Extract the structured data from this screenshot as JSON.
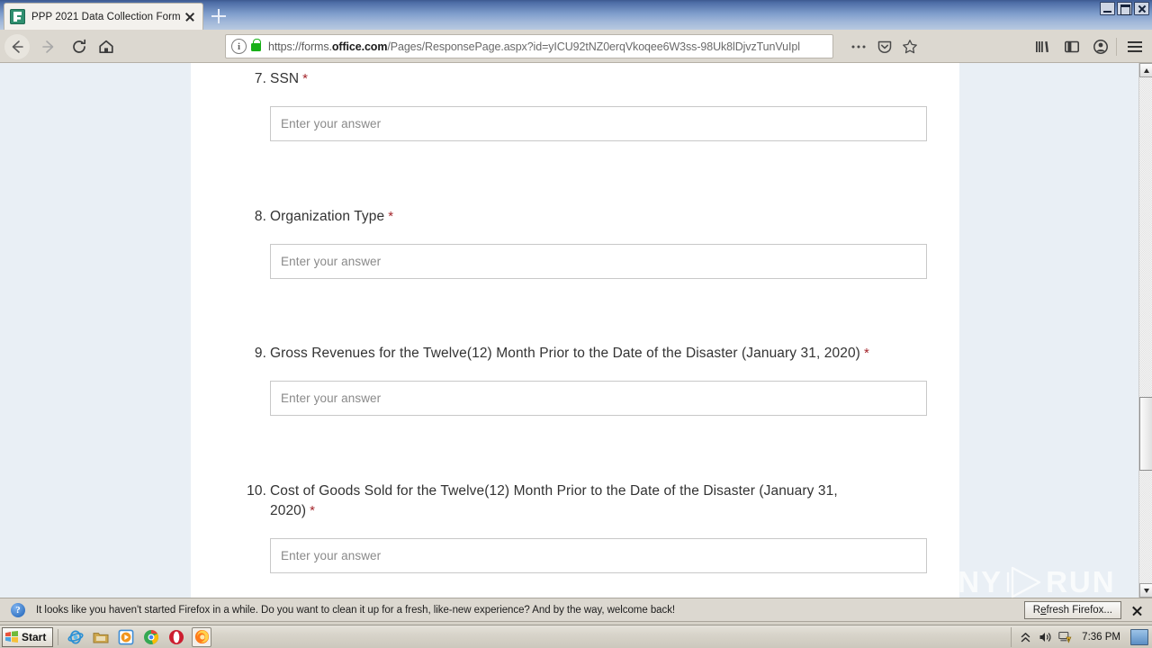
{
  "browser": {
    "tab": {
      "title": "PPP 2021 Data Collection Form",
      "favicon": "microsoft-forms-icon",
      "close_label": "×"
    },
    "newtab_label": "+",
    "window_controls": {
      "minimize": "minimize-icon",
      "restore": "restore-icon",
      "close": "close-icon"
    },
    "nav": {
      "back": "back-arrow-icon",
      "forward": "forward-arrow-icon",
      "reload": "reload-icon",
      "home": "home-icon"
    },
    "urlbar": {
      "identity_icon": "i",
      "lock_icon": "lock-icon",
      "url_prefix": "https://forms.",
      "url_domain": "office.com",
      "url_suffix": "/Pages/ResponsePage.aspx?id=yICU92tNZ0erqVkoqee6W3ss-98Uk8lDjvzTunVuIpl",
      "page_actions": "ellipsis-icon",
      "pocket": "pocket-icon",
      "bookmark": "star-icon"
    },
    "toolbar": {
      "library": "library-icon",
      "sidebar": "sidebar-icon",
      "account": "account-icon",
      "menu": "hamburger-menu-icon"
    }
  },
  "form": {
    "placeholder": "Enter your answer",
    "required_marker": "*",
    "questions": [
      {
        "number": "7.",
        "text": "SSN",
        "required": true,
        "lines": [
          "SSN"
        ]
      },
      {
        "number": "8.",
        "text": "Organization Type",
        "required": true,
        "lines": [
          "Organization Type"
        ]
      },
      {
        "number": "9.",
        "text": "Gross Revenues for the Twelve(12) Month Prior to the Date of the Disaster (January 31, 2020)",
        "required": true,
        "lines": [
          "Gross Revenues for the Twelve(12) Month Prior to the Date of the Disaster (January 31, 2020)"
        ]
      },
      {
        "number": "10.",
        "text": "Cost of Goods Sold for the Twelve(12) Month Prior to the Date of the Disaster (January 31, 2020)",
        "required": true,
        "lines": [
          "Cost of Goods Sold for the Twelve(12) Month Prior to the Date of the Disaster (January 31,",
          "2020)"
        ]
      }
    ]
  },
  "notification": {
    "icon": "info-icon",
    "message": "It looks like you haven't started Firefox in a while. Do you want to clean it up for a fresh, like-new experience? And by the way, welcome back!",
    "button_prefix": "R",
    "button_accel": "e",
    "button_suffix": "fresh Firefox...",
    "close": "close-icon"
  },
  "watermark": {
    "left": "ANY",
    "right": "RUN",
    "logo": "play-button-logo"
  },
  "taskbar": {
    "start_label": "Start",
    "quicklaunch": [
      {
        "name": "internet-explorer-icon"
      },
      {
        "name": "folder-icon"
      },
      {
        "name": "media-player-icon"
      },
      {
        "name": "chrome-icon"
      },
      {
        "name": "opera-icon"
      },
      {
        "name": "firefox-icon",
        "active": true
      }
    ],
    "tray": {
      "chevron": "show-hidden-icons-icon",
      "volume": "volume-icon",
      "network": "network-warning-icon",
      "time": "7:36 PM",
      "show_desktop": "show-desktop-icon"
    }
  },
  "colors": {
    "titlebar": "#4c6ca5",
    "chrome": "#dcd8d0",
    "page_bg": "#e9eff5",
    "card_bg": "#ffffff",
    "required": "#a4262c",
    "lock_green": "#18b018"
  }
}
